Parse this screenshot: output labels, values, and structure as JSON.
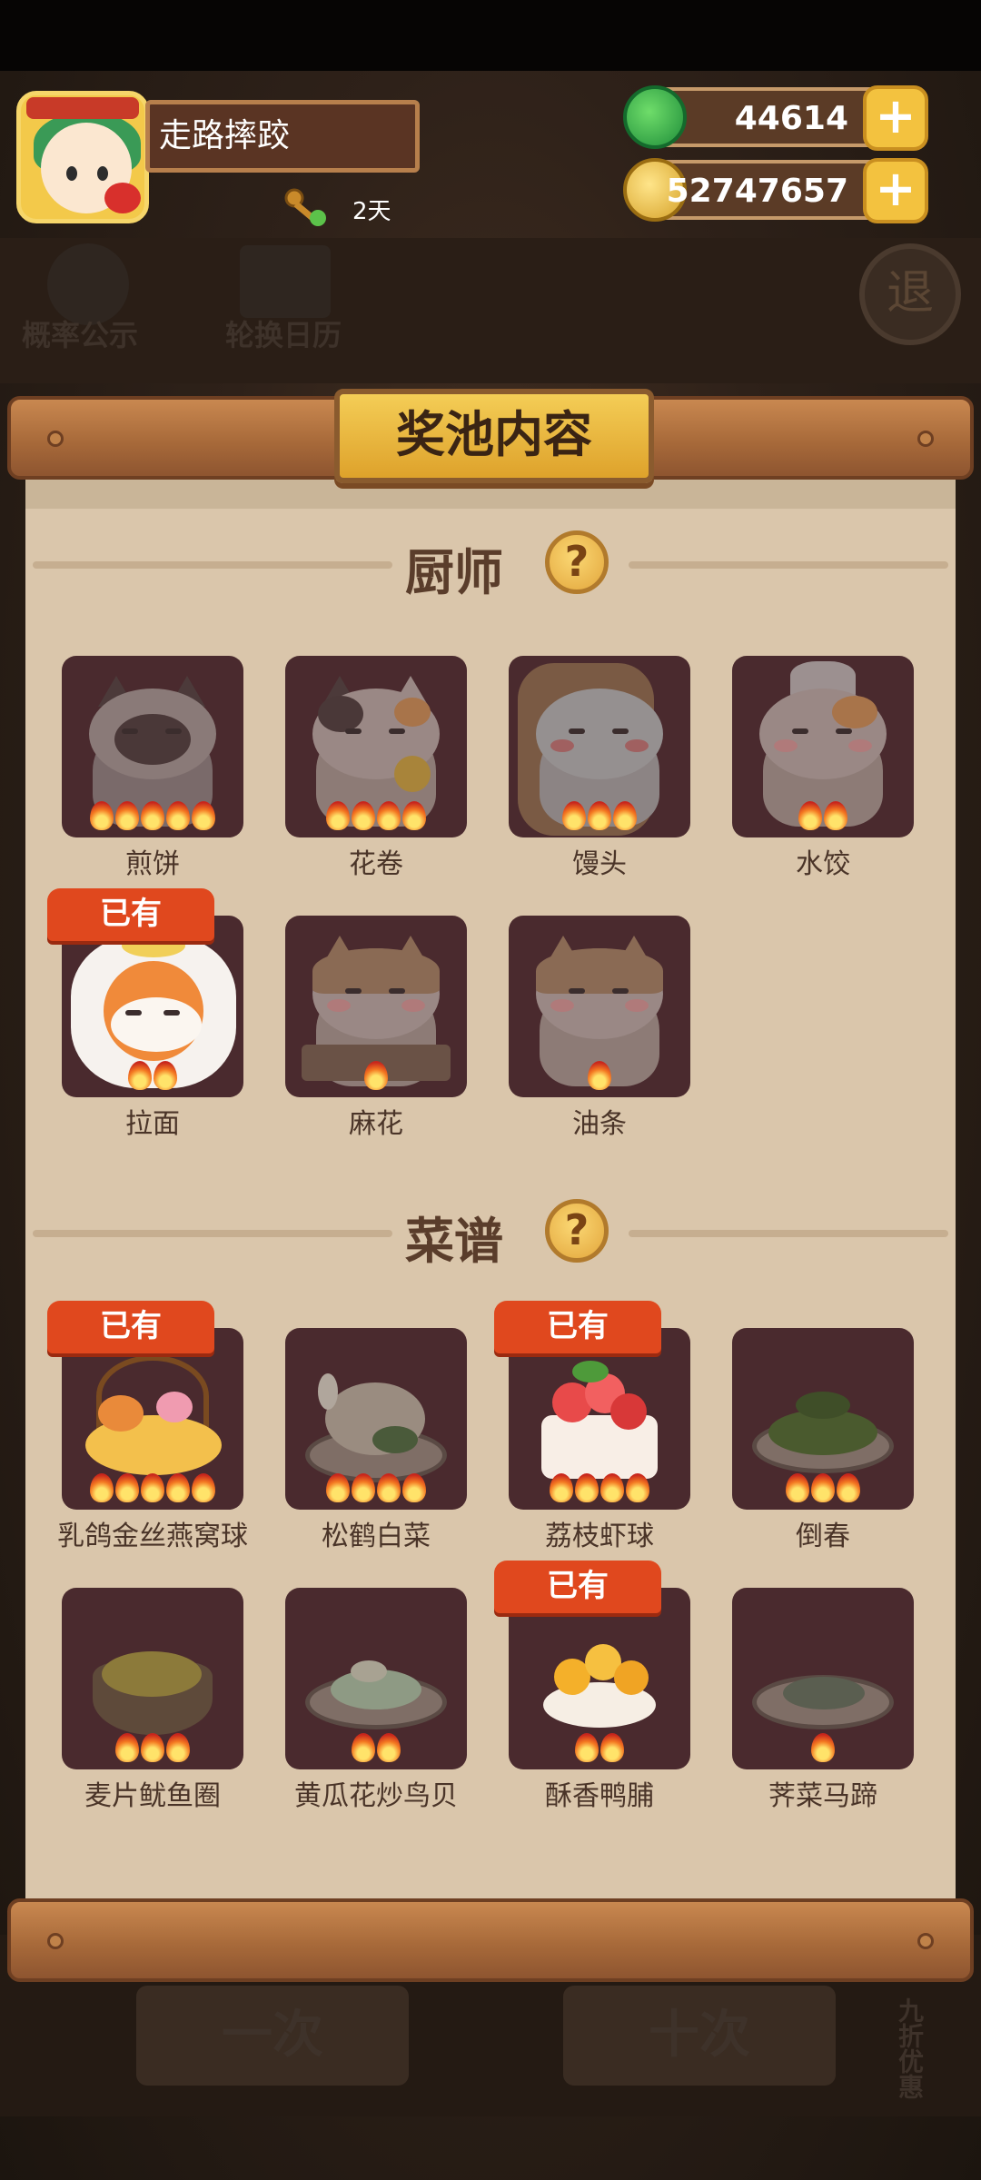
{
  "player": {
    "name": "走路摔跤",
    "days": "2天"
  },
  "currency": {
    "jade": "44614",
    "gold": "52747657"
  },
  "background_labels": {
    "probability": "概率公示",
    "calendar": "轮换日历",
    "exit": "退",
    "single": "一次",
    "ten": "十次",
    "discount": "九折优惠"
  },
  "dialog": {
    "title": "奖池内容",
    "owned_badge": "已有",
    "help_symbol": "?",
    "chef_section": {
      "title": "厨师",
      "items": [
        {
          "name": "煎饼",
          "stars": 5,
          "owned": false
        },
        {
          "name": "花卷",
          "stars": 4,
          "owned": false
        },
        {
          "name": "馒头",
          "stars": 3,
          "owned": false
        },
        {
          "name": "水饺",
          "stars": 2,
          "owned": false
        },
        {
          "name": "拉面",
          "stars": 2,
          "owned": true
        },
        {
          "name": "麻花",
          "stars": 1,
          "owned": false
        },
        {
          "name": "油条",
          "stars": 1,
          "owned": false
        }
      ]
    },
    "recipe_section": {
      "title": "菜谱",
      "items": [
        {
          "name": "乳鸽金丝燕窝球",
          "stars": 5,
          "owned": true
        },
        {
          "name": "松鹤白菜",
          "stars": 4,
          "owned": false
        },
        {
          "name": "荔枝虾球",
          "stars": 4,
          "owned": true
        },
        {
          "name": "倒春",
          "stars": 3,
          "owned": false
        },
        {
          "name": "麦片鱿鱼圈",
          "stars": 3,
          "owned": false
        },
        {
          "name": "黄瓜花炒鸟贝",
          "stars": 2,
          "owned": false
        },
        {
          "name": "酥香鸭脯",
          "stars": 2,
          "owned": true
        },
        {
          "name": "荠菜马蹄",
          "stars": 1,
          "owned": false
        }
      ]
    }
  },
  "colors": {
    "owned_badge": "#e0481e",
    "panel": "#dac6ab",
    "tile": "#4a2a2e",
    "title_plate": "#f4cd56"
  }
}
